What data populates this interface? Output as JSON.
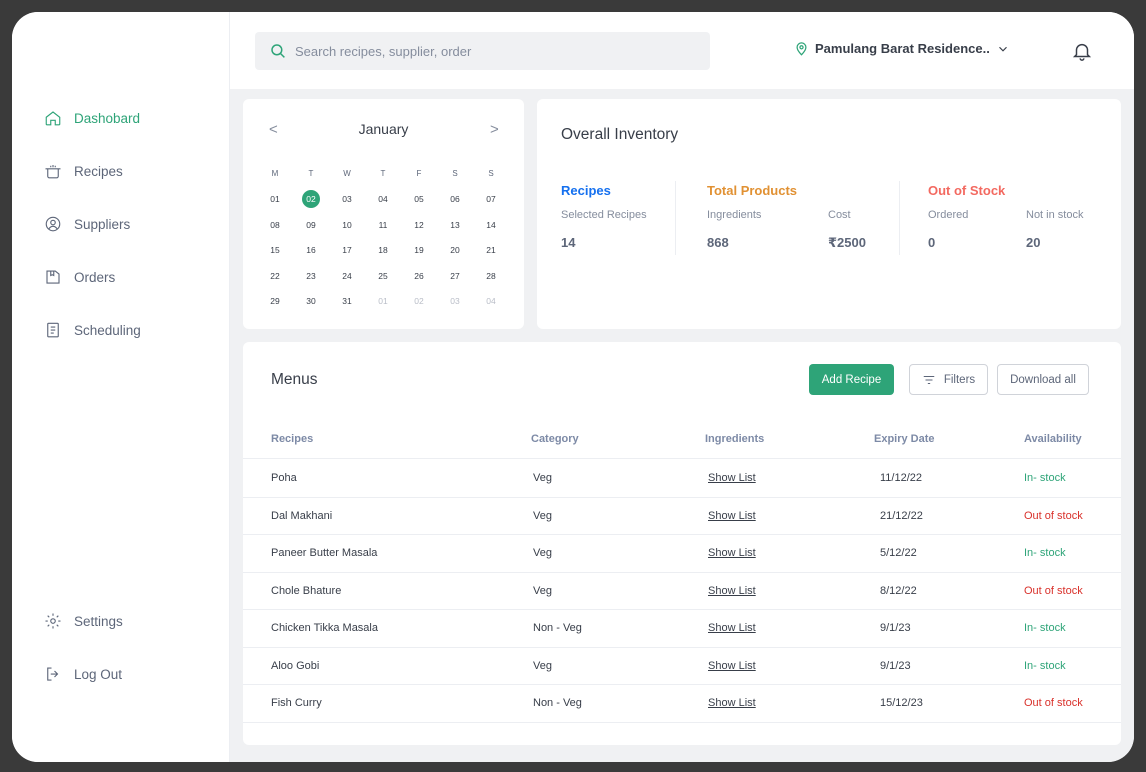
{
  "nav": {
    "items": [
      {
        "label": "Dashobard",
        "icon": "home-icon",
        "active": true
      },
      {
        "label": "Recipes",
        "icon": "pot-icon"
      },
      {
        "label": "Suppliers",
        "icon": "user-circle-icon"
      },
      {
        "label": "Orders",
        "icon": "box-icon"
      },
      {
        "label": "Scheduling",
        "icon": "clipboard-icon"
      }
    ],
    "bottom": [
      {
        "label": "Settings",
        "icon": "gear-icon"
      },
      {
        "label": "Log Out",
        "icon": "logout-icon"
      }
    ]
  },
  "topbar": {
    "search_placeholder": "Search recipes, supplier, order",
    "location": "Pamulang Barat Residence.."
  },
  "calendar": {
    "month": "January",
    "prev": "<",
    "next": ">",
    "weekdays": [
      "M",
      "T",
      "W",
      "T",
      "F",
      "S",
      "S"
    ],
    "weeks": [
      [
        "01",
        "02",
        "03",
        "04",
        "05",
        "06",
        "07"
      ],
      [
        "08",
        "09",
        "10",
        "11",
        "12",
        "13",
        "14"
      ],
      [
        "15",
        "16",
        "17",
        "18",
        "19",
        "20",
        "21"
      ],
      [
        "22",
        "23",
        "24",
        "25",
        "26",
        "27",
        "28"
      ],
      [
        "29",
        "30",
        "31",
        "01",
        "02",
        "03",
        "04"
      ]
    ],
    "selected": "02",
    "muted_last_row_from": 3
  },
  "inventory": {
    "title": "Overall Inventory",
    "recipes": {
      "heading": "Recipes",
      "label": "Selected Recipes",
      "value": "14",
      "color": "#1570ef"
    },
    "products": {
      "heading": "Total Products",
      "color": "#e19133",
      "ingredients_label": "Ingredients",
      "ingredients_value": "868",
      "cost_label": "Cost",
      "cost_value": "₹2500"
    },
    "stock": {
      "heading": "Out of Stock",
      "color": "#f36960",
      "ordered_label": "Ordered",
      "ordered_value": "0",
      "notin_label": "Not in stock",
      "notin_value": "20"
    }
  },
  "menus": {
    "title": "Menus",
    "add_label": "Add Recipe",
    "filters_label": "Filters",
    "download_label": "Download all",
    "columns": [
      "Recipes",
      "Category",
      "Ingredients",
      "Expiry Date",
      "Availability"
    ],
    "rows": [
      {
        "name": "Poha",
        "category": "Veg",
        "ingredients": "Show List",
        "expiry": "11/12/22",
        "availability": "In- stock",
        "status": "in"
      },
      {
        "name": "Dal Makhani",
        "category": "Veg",
        "ingredients": "Show List",
        "expiry": "21/12/22",
        "availability": "Out of stock",
        "status": "out"
      },
      {
        "name": "Paneer Butter Masala",
        "category": "Veg",
        "ingredients": "Show List",
        "expiry": "5/12/22",
        "availability": "In- stock",
        "status": "in"
      },
      {
        "name": "Chole Bhature",
        "category": "Veg",
        "ingredients": "Show List",
        "expiry": "8/12/22",
        "availability": "Out of stock",
        "status": "out"
      },
      {
        "name": "Chicken Tikka Masala",
        "category": "Non - Veg",
        "ingredients": "Show List",
        "expiry": "9/1/23",
        "availability": "In- stock",
        "status": "in"
      },
      {
        "name": "Aloo Gobi",
        "category": "Veg",
        "ingredients": "Show List",
        "expiry": "9/1/23",
        "availability": "In- stock",
        "status": "in"
      },
      {
        "name": "Fish Curry",
        "category": "Non - Veg",
        "ingredients": "Show List",
        "expiry": "15/12/23",
        "availability": "Out of stock",
        "status": "out"
      }
    ]
  }
}
